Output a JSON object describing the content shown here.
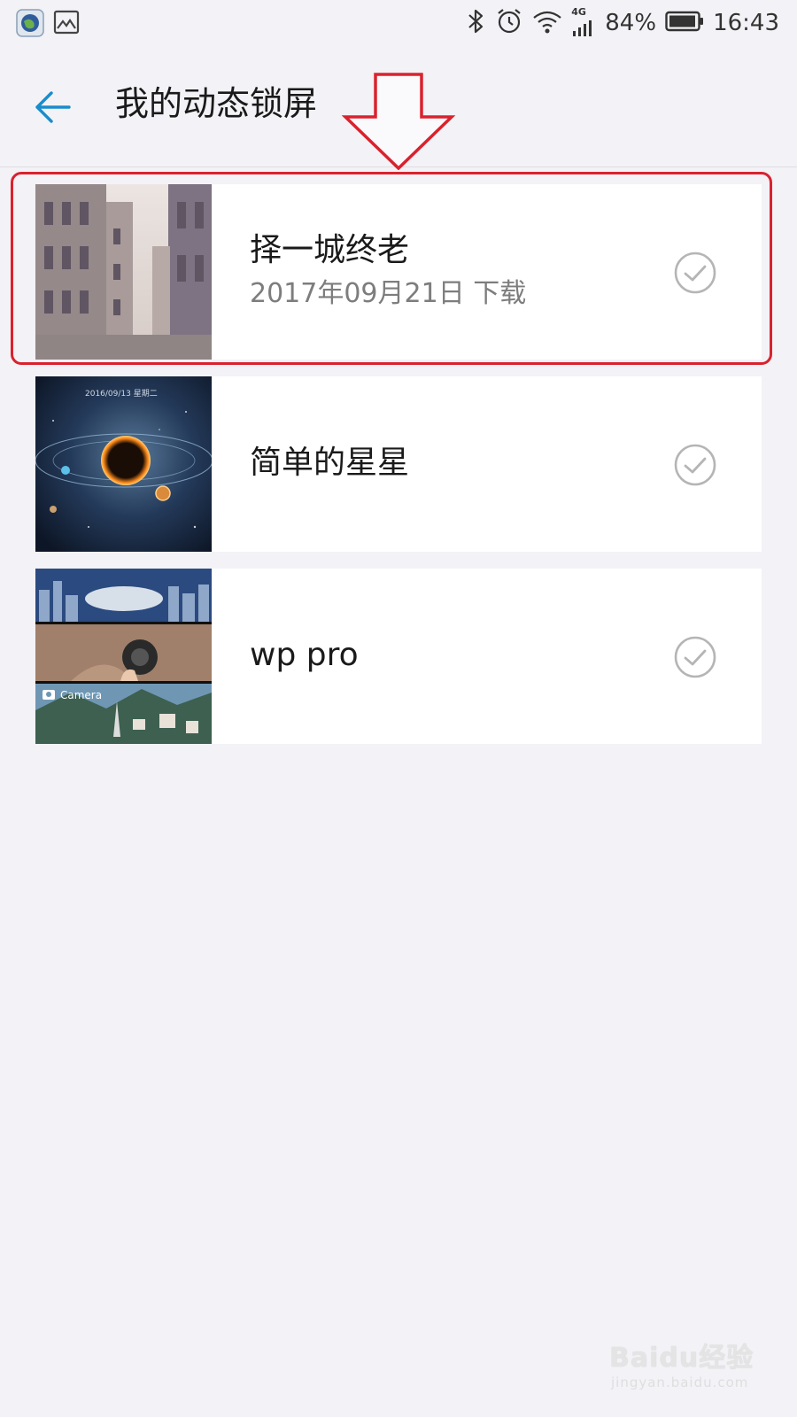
{
  "status_bar": {
    "battery_percent": "84%",
    "time": "16:43",
    "network": "4G",
    "icons_left": [
      "browser-app-icon",
      "gallery-notification-icon"
    ],
    "icons_right": [
      "bluetooth-icon",
      "alarm-icon",
      "wifi-icon",
      "cellular-signal-icon",
      "battery-icon"
    ]
  },
  "header": {
    "title": "我的动态锁屏",
    "back_icon": "arrow-left-icon",
    "accent_color": "#1a8ccc"
  },
  "annotation": {
    "color": "#d9222e"
  },
  "items": [
    {
      "title": "择一城终老",
      "subtitle": "2017年09月21日 下载",
      "thumbnail": "old-town-street-photo",
      "highlighted": true
    },
    {
      "title": "简单的星星",
      "thumbnail": "space-planet-lockscreen",
      "thumb_caption": "2016/09/13  星期二",
      "highlighted": false
    },
    {
      "title": "wp pro",
      "thumbnail": "windows-phone-collage",
      "thumb_caption": "Camera",
      "highlighted": false
    }
  ],
  "watermark": {
    "brand": "Baidu经验",
    "url": "jingyan.baidu.com"
  }
}
